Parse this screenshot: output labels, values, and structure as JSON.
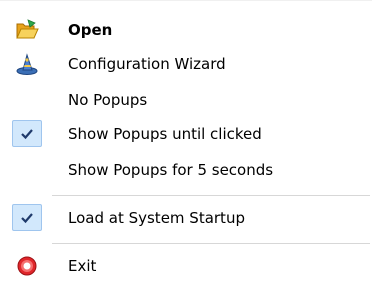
{
  "menu": {
    "items": [
      {
        "label": "Open",
        "icon": "folder-open-icon",
        "bold": true
      },
      {
        "label": "Configuration Wizard",
        "icon": "wizard-icon"
      },
      {
        "label": "No Popups"
      },
      {
        "label": "Show Popups until clicked",
        "checked": true
      },
      {
        "label": "Show Popups for 5 seconds"
      },
      {
        "label": "Load at System Startup",
        "checked": true
      },
      {
        "label": "Exit",
        "icon": "exit-icon"
      }
    ]
  },
  "colors": {
    "check_highlight": "#d2e8fc",
    "check_border": "#9fc5ee",
    "check_mark": "#1f3a6b",
    "separator": "#d7d7d7",
    "exit_red": "#e0262b"
  }
}
